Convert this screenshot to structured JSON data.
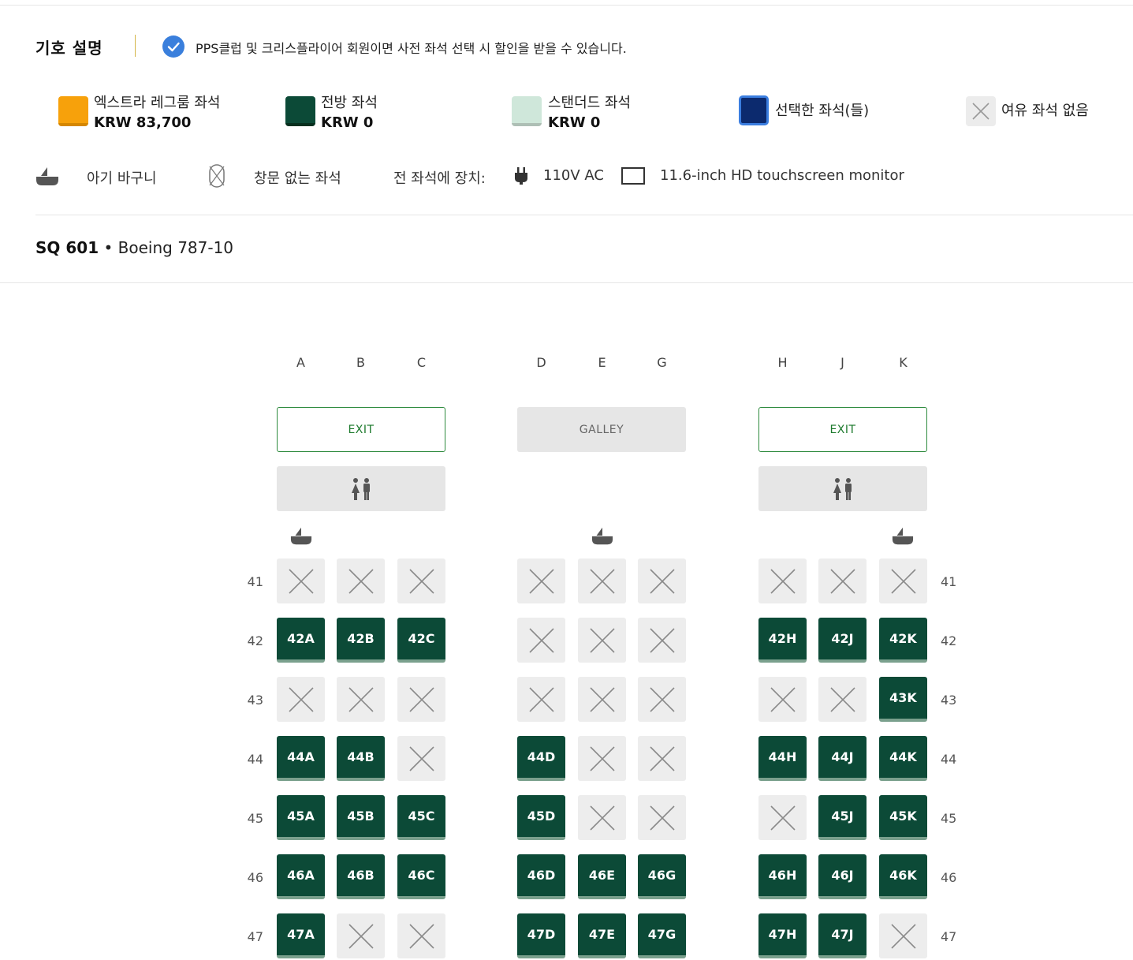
{
  "legend": {
    "title": "기호 설명",
    "discount_note": "PPS클럽 및 크리스플라이어 회원이면 사전 좌석 선택 시 할인을 받을 수 있습니다.",
    "items": [
      {
        "name": "엑스트라 레그룸 좌석",
        "price": "KRW 83,700",
        "color": "#f7a10b"
      },
      {
        "name": "전방 좌석",
        "price": "KRW 0",
        "color": "#0c4a37"
      },
      {
        "name": "스탠더드 좌석",
        "price": "KRW 0",
        "color": "#cfe7da"
      },
      {
        "name": "선택한 좌석(들)",
        "price": "",
        "color": "#0c2a6e"
      },
      {
        "name": "여유 좌석 없음",
        "price": "",
        "color": "#ececec"
      }
    ],
    "features": {
      "bassinet": "아기 바구니",
      "no_window": "창문 없는 좌석",
      "all_seats": "전 좌석에 장치:",
      "power": "110V AC",
      "monitor": "11.6-inch HD touchscreen monitor"
    }
  },
  "flight": {
    "number": "SQ 601",
    "separator": " • ",
    "aircraft": "Boeing 787-10"
  },
  "seatmap": {
    "columns": [
      "A",
      "B",
      "C",
      "D",
      "E",
      "G",
      "H",
      "J",
      "K"
    ],
    "facilities": {
      "exit_left": "EXIT",
      "galley": "GALLEY",
      "exit_right": "EXIT"
    },
    "rows": [
      {
        "number": "41",
        "seats": [
          "",
          "",
          "",
          "",
          "",
          "",
          "",
          "",
          ""
        ]
      },
      {
        "number": "42",
        "seats": [
          "42A",
          "42B",
          "42C",
          "",
          "",
          "",
          "42H",
          "42J",
          "42K"
        ]
      },
      {
        "number": "43",
        "seats": [
          "",
          "",
          "",
          "",
          "",
          "",
          "",
          "",
          "43K"
        ]
      },
      {
        "number": "44",
        "seats": [
          "44A",
          "44B",
          "",
          "44D",
          "",
          "",
          "44H",
          "44J",
          "44K"
        ]
      },
      {
        "number": "45",
        "seats": [
          "45A",
          "45B",
          "45C",
          "45D",
          "",
          "",
          "",
          "45J",
          "45K"
        ]
      },
      {
        "number": "46",
        "seats": [
          "46A",
          "46B",
          "46C",
          "46D",
          "46E",
          "46G",
          "46H",
          "46J",
          "46K"
        ]
      },
      {
        "number": "47",
        "seats": [
          "47A",
          "",
          "",
          "47D",
          "47E",
          "47G",
          "47H",
          "47J",
          ""
        ]
      }
    ]
  },
  "colors": {
    "forward_seat": "#0c4a37",
    "unavailable": "#ededed",
    "exit_border": "#2e8b3e",
    "check": "#3a7fdc"
  }
}
